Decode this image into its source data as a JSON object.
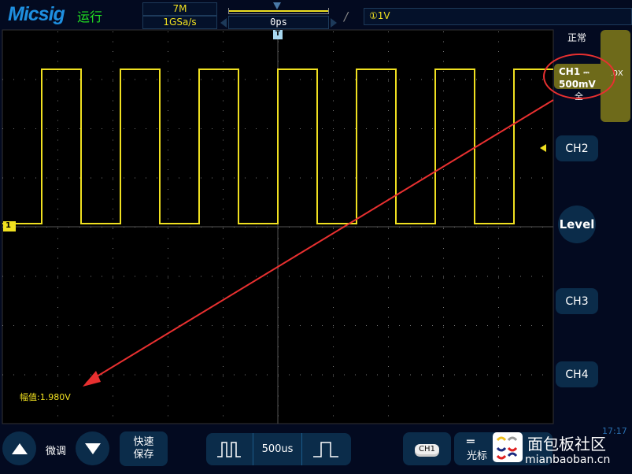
{
  "header": {
    "brand": "Micsig",
    "run_state": "运行",
    "memory_depth": "7M",
    "sample_rate": "1GSa/s",
    "trigger_position": "0ps",
    "trigger_edge_icon": "rising-edge-icon",
    "trigger_level": "①1V"
  },
  "screen": {
    "trigger_marker": "T",
    "channel_marker": "1",
    "amplitude_label": "幅值:1.980V"
  },
  "right_panel": {
    "acquire_mode": "正常",
    "ch1_label": "CH1",
    "ch1_coupling": "⎓",
    "ch1_scale": "500mV",
    "ch1_bandwidth": "全",
    "probe": "10X",
    "ch2_label": "CH2",
    "level_label": "Level",
    "ch3_label": "CH3",
    "ch4_label": "CH4",
    "clock": "17:17"
  },
  "bottom": {
    "fine_tune": "微调",
    "quick_save": "快速\n保存",
    "quick_save_line1": "快速",
    "quick_save_line2": "保存",
    "timebase": "500us",
    "ch1_badge": "CH1",
    "cursor_label": "光标",
    "cursor_label2": "光标"
  },
  "watermark": {
    "name": "面包板社区",
    "url": "mianbaoban.cn"
  },
  "colors": {
    "ch1": "#f0e020",
    "accent": "#0b2c4a",
    "annotation": "#e83030"
  }
}
